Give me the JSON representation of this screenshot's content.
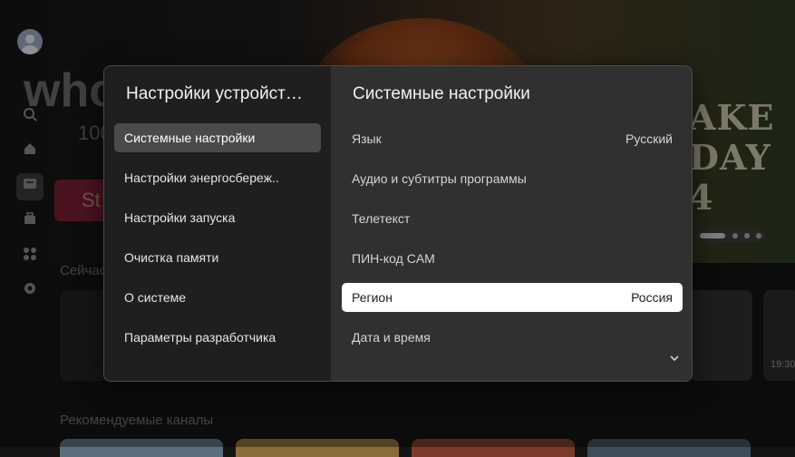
{
  "background": {
    "hero_logo": "who",
    "hero_sub": "100",
    "hero_button": "St",
    "hero_promo_text": "AKE\nDAY\n4",
    "row_now_title": "Сейчас",
    "row_recommended_title": "Рекомендуемые каналы",
    "tile_time": "19:30"
  },
  "dialog": {
    "left_title": "Настройки устройст…",
    "right_title": "Системные настройки",
    "menu": [
      {
        "label": "Системные настройки",
        "selected": true
      },
      {
        "label": "Настройки энергосбереж.."
      },
      {
        "label": "Настройки запуска"
      },
      {
        "label": "Очистка памяти"
      },
      {
        "label": "О системе"
      },
      {
        "label": "Параметры разработчика"
      }
    ],
    "settings": [
      {
        "label": "Язык",
        "value": "Русский"
      },
      {
        "label": "Аудио и субтитры программы",
        "value": ""
      },
      {
        "label": "Телетекст",
        "value": ""
      },
      {
        "label": "ПИН-код CAM",
        "value": ""
      },
      {
        "label": "Регион",
        "value": "Россия",
        "focused": true
      },
      {
        "label": "Дата и время",
        "value": ""
      }
    ],
    "scroll_indicator_icon": "chevron-down-icon"
  },
  "colors": {
    "dialog_left_bg": "#1f1f1f",
    "dialog_right_bg": "#303030",
    "selected_menu_bg": "#4a4a4a",
    "focused_row_bg": "#ffffff"
  }
}
